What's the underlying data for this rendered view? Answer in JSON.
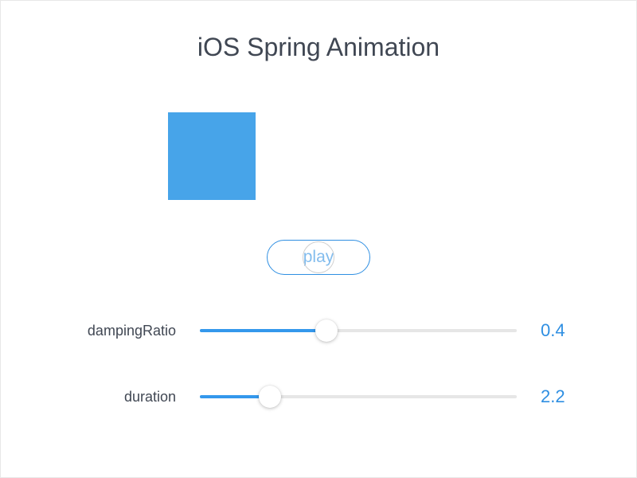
{
  "title": "iOS Spring Animation",
  "playButton": {
    "label": "play"
  },
  "square": {
    "color": "#47a4e9"
  },
  "controls": {
    "dampingRatio": {
      "label": "dampingRatio",
      "value": "0.4",
      "percent": 40
    },
    "duration": {
      "label": "duration",
      "value": "2.2",
      "percent": 22
    }
  },
  "colors": {
    "accent": "#2f8fe2",
    "sliderFill": "#3498ec",
    "text": "#404753"
  }
}
